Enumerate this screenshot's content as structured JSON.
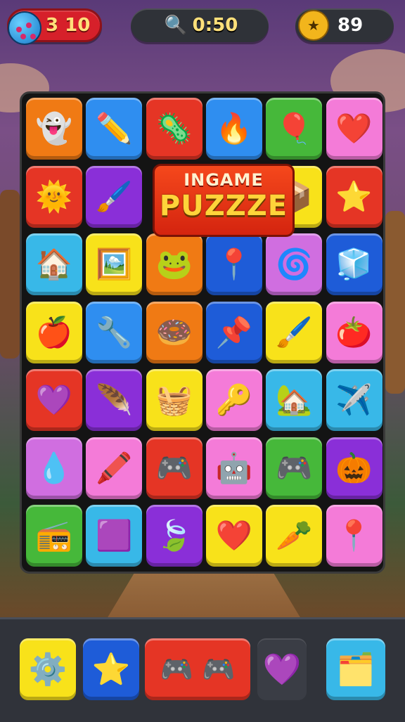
{
  "hud": {
    "lives_value": "3 10",
    "lives_icon": "lives-ball-icon",
    "timer_value": "0:50",
    "timer_icon": "magnifier-icon",
    "coins_value": "89",
    "coins_icon": "coin-icon"
  },
  "banner": {
    "line1": "INGAME",
    "line2": "PUZZZE"
  },
  "board": {
    "rows": [
      [
        {
          "icon": "green-blob-icon",
          "glyph": "👻",
          "color": "orange"
        },
        {
          "icon": "pencil-icon",
          "glyph": "✏️",
          "color": "blue"
        },
        {
          "icon": "germ-icon",
          "glyph": "🦠",
          "color": "red"
        },
        {
          "icon": "fire-icon",
          "glyph": "🔥",
          "color": "blue"
        },
        {
          "icon": "balloon-icon",
          "glyph": "🎈",
          "color": "green"
        },
        {
          "icon": "heart-icon",
          "glyph": "❤️",
          "color": "pink"
        }
      ],
      [
        {
          "icon": "sun-face-icon",
          "glyph": "🌞",
          "color": "red"
        },
        {
          "icon": "paintbrushes-icon",
          "glyph": "🖌️",
          "color": "purple"
        },
        null,
        null,
        {
          "icon": "box-icon",
          "glyph": "📦",
          "color": "yellow"
        },
        {
          "icon": "star-icon",
          "glyph": "⭐",
          "color": "red"
        }
      ],
      [
        {
          "icon": "house-icon",
          "glyph": "🏠",
          "color": "cyan"
        },
        {
          "icon": "frame-icon",
          "glyph": "🖼️",
          "color": "yellow"
        },
        {
          "icon": "green-slime-icon",
          "glyph": "🐸",
          "color": "orange"
        },
        {
          "icon": "map-pin-icon",
          "glyph": "📍",
          "color": "navy"
        },
        {
          "icon": "swirl-icon",
          "glyph": "🌀",
          "color": "lilac"
        },
        {
          "icon": "cube-icon",
          "glyph": "🧊",
          "color": "navy"
        }
      ],
      [
        {
          "icon": "apple-icon",
          "glyph": "🍎",
          "color": "yellow"
        },
        {
          "icon": "pliers-icon",
          "glyph": "🔧",
          "color": "blue"
        },
        {
          "icon": "donut-icon",
          "glyph": "🍩",
          "color": "orange"
        },
        {
          "icon": "location-pin-icon",
          "glyph": "📌",
          "color": "navy"
        },
        {
          "icon": "brush-icon",
          "glyph": "🖌️",
          "color": "yellow"
        },
        {
          "icon": "tomato-icon",
          "glyph": "🍅",
          "color": "pink"
        }
      ],
      [
        {
          "icon": "heart-icon",
          "glyph": "💜",
          "color": "red"
        },
        {
          "icon": "feather-icon",
          "glyph": "🪶",
          "color": "purple"
        },
        {
          "icon": "basket-icon",
          "glyph": "🧺",
          "color": "yellow"
        },
        {
          "icon": "key-icon",
          "glyph": "🔑",
          "color": "pink"
        },
        {
          "icon": "barn-icon",
          "glyph": "🏡",
          "color": "cyan"
        },
        {
          "icon": "paper-plane-icon",
          "glyph": "✈️",
          "color": "cyan"
        }
      ],
      [
        {
          "icon": "blue-drop-icon",
          "glyph": "💧",
          "color": "lilac"
        },
        {
          "icon": "crayon-icon",
          "glyph": "🖍️",
          "color": "pink"
        },
        {
          "icon": "gamepad-icon",
          "glyph": "🎮",
          "color": "red"
        },
        {
          "icon": "robot-face-icon",
          "glyph": "🤖",
          "color": "pink"
        },
        {
          "icon": "gamepad-icon",
          "glyph": "🎮",
          "color": "green"
        },
        {
          "icon": "pumpkin-icon",
          "glyph": "🎃",
          "color": "purple"
        }
      ],
      [
        {
          "icon": "radio-icon",
          "glyph": "📻",
          "color": "green"
        },
        {
          "icon": "purple-cube-icon",
          "glyph": "🟪",
          "color": "cyan"
        },
        {
          "icon": "leaf-icon",
          "glyph": "🍃",
          "color": "purple"
        },
        {
          "icon": "heart-icon",
          "glyph": "❤️",
          "color": "yellow"
        },
        {
          "icon": "carrot-icon",
          "glyph": "🥕",
          "color": "yellow"
        },
        {
          "icon": "pin-icon",
          "glyph": "📍",
          "color": "pink"
        }
      ]
    ]
  },
  "tray": [
    {
      "icon": "gear-magnet-icon",
      "glyph": "⚙️",
      "color": "yellow"
    },
    {
      "icon": "star-icon",
      "glyph": "⭐",
      "color": "navy"
    },
    {
      "icon": "controllers-icon",
      "glyph": "🎮 🎮",
      "color": "red"
    },
    {
      "icon": "heart-icon",
      "glyph": "💜",
      "color": "dark"
    },
    {
      "icon": "card-icon",
      "glyph": "🗂️",
      "color": "cyan"
    }
  ]
}
